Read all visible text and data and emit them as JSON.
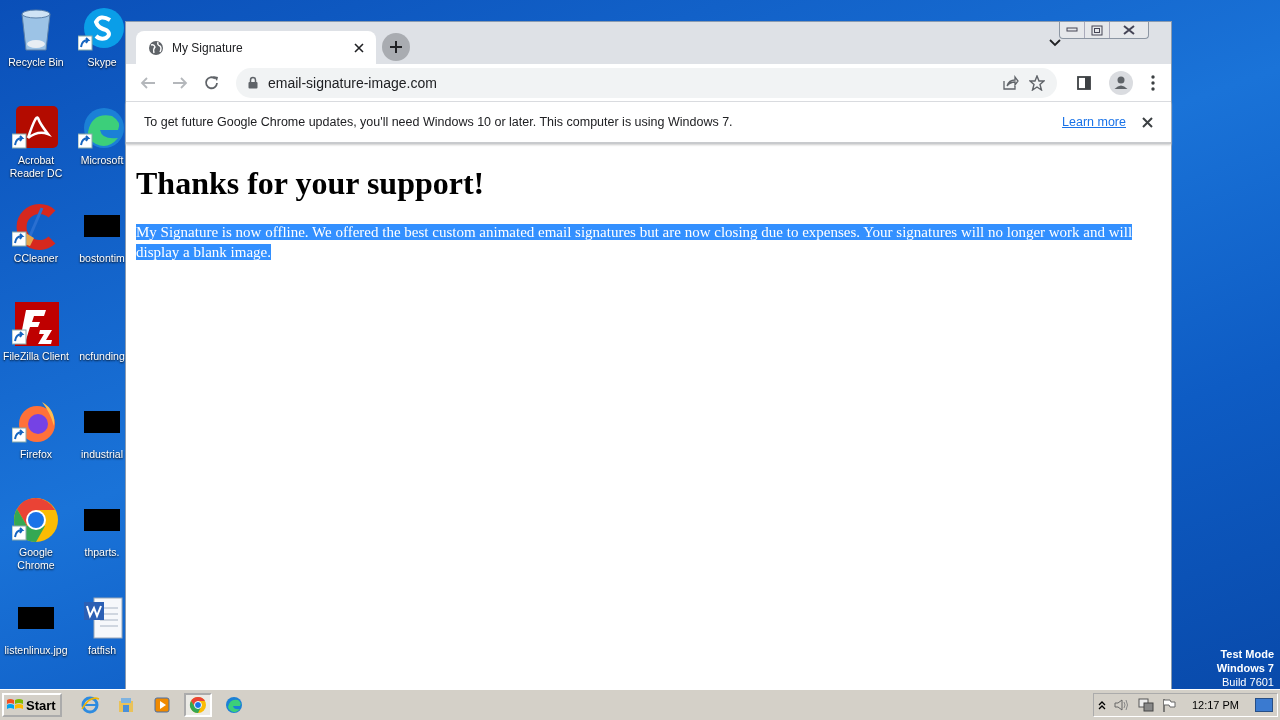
{
  "desktop": {
    "columns": [
      {
        "icons": [
          {
            "label": "Recycle Bin",
            "kind": "recycle"
          },
          {
            "label": "Acrobat Reader DC",
            "kind": "acrobat"
          },
          {
            "label": "CCleaner",
            "kind": "ccleaner"
          },
          {
            "label": "FileZilla Client",
            "kind": "filezilla"
          },
          {
            "label": "Firefox",
            "kind": "firefox"
          },
          {
            "label": "Google Chrome",
            "kind": "chrome"
          },
          {
            "label": "listenlinux.jpg",
            "kind": "redacted"
          }
        ]
      },
      {
        "icons": [
          {
            "label": "Skype",
            "kind": "skype"
          },
          {
            "label": "Microsoft",
            "kind": "edge"
          },
          {
            "label": "bostontim",
            "kind": "redacted"
          },
          {
            "label": "ncfunding",
            "kind": "blank"
          },
          {
            "label": "industrial",
            "kind": "redacted"
          },
          {
            "label": "thparts.",
            "kind": "redacted"
          },
          {
            "label": "fatfish",
            "kind": "word"
          }
        ]
      }
    ],
    "notice": [
      "Test Mode",
      "Windows 7",
      "Build 7601"
    ]
  },
  "browser": {
    "tabs": [
      {
        "title": "My Signature",
        "selected": true
      }
    ],
    "nav_buttons": [
      {
        "kind": "back",
        "disabled": true
      },
      {
        "kind": "forward",
        "disabled": true
      },
      {
        "kind": "reload",
        "disabled": false
      }
    ],
    "address": "email-signature-image.com",
    "infobar": {
      "message": "To get future Google Chrome updates, you'll need Windows 10 or later. This computer is using Windows 7.",
      "link": "Learn more"
    },
    "page": {
      "heading": "Thanks for your support!",
      "paragraph": "My Signature is now offline. We offered the best custom animated email signatures but are now closing due to expenses. Your signatures will no longer work and will display a blank image.",
      "selected": true
    }
  },
  "taskbar": {
    "start": "Start",
    "apps": [
      {
        "kind": "ie",
        "selected": false
      },
      {
        "kind": "explorer",
        "selected": false
      },
      {
        "kind": "media",
        "selected": false
      },
      {
        "kind": "chrome",
        "selected": true
      },
      {
        "kind": "edge",
        "selected": false
      }
    ],
    "clock": "12:17 PM"
  }
}
